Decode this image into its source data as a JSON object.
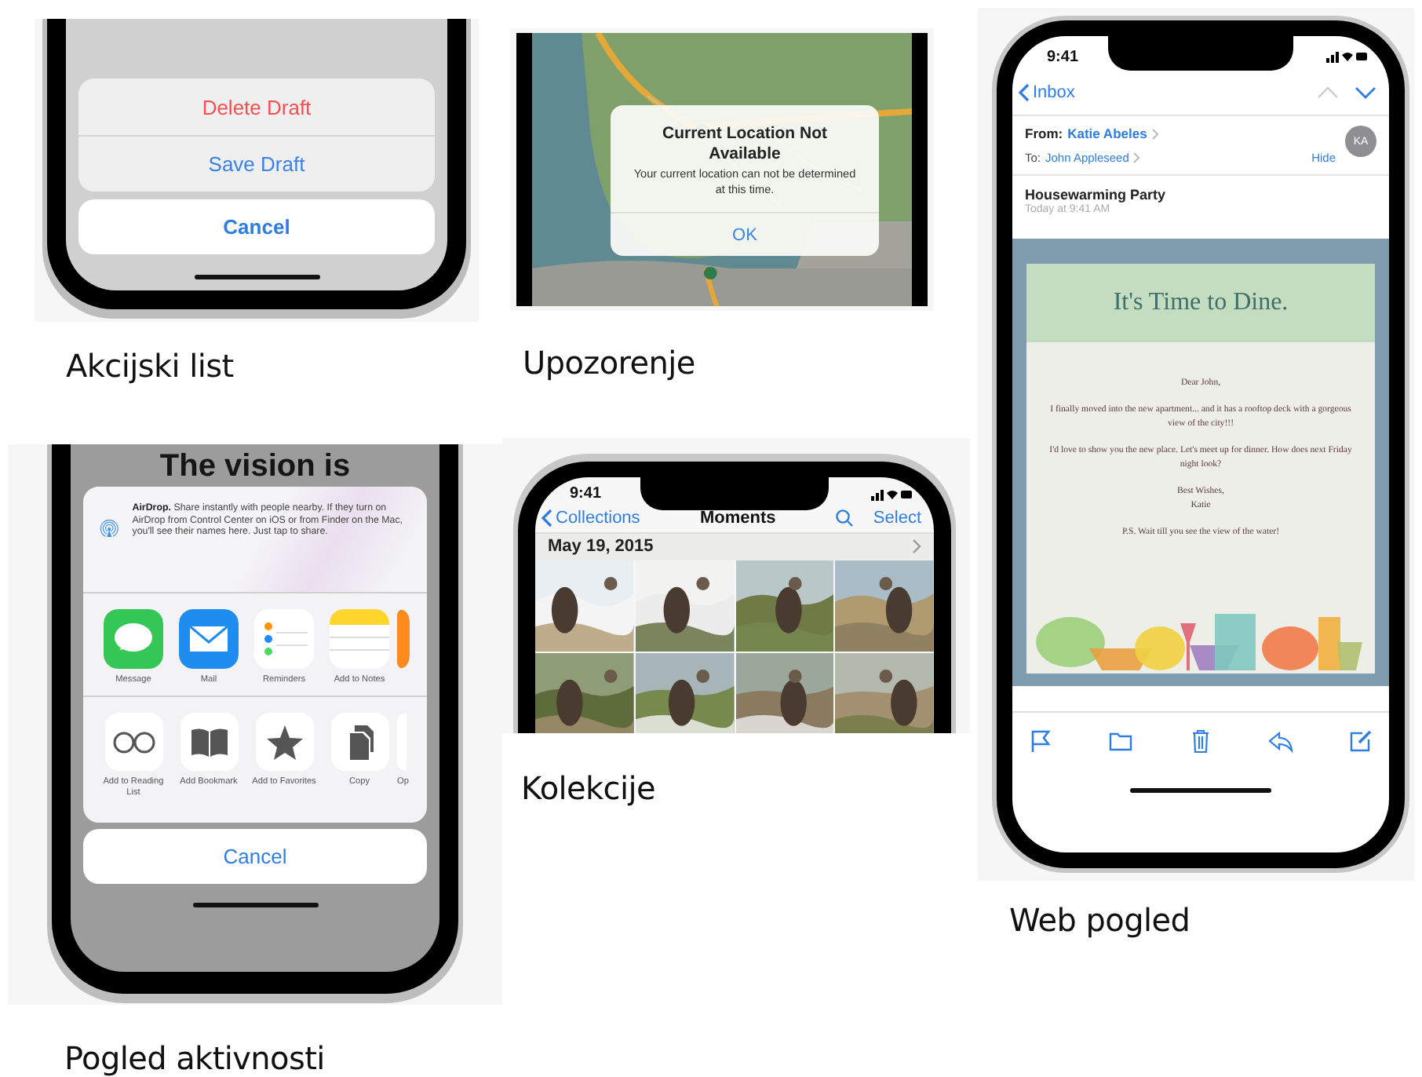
{
  "action_sheet": {
    "actions": [
      {
        "label": "Delete Draft",
        "destructive": true
      },
      {
        "label": "Save Draft",
        "destructive": false
      }
    ],
    "cancel": "Cancel",
    "caption": "Akcijski list"
  },
  "activity_view": {
    "background_text": "The vision is",
    "airdrop": {
      "title": "AirDrop.",
      "text": "Share instantly with people nearby. If they turn on AirDrop from Control Center on iOS or from Finder on the Mac, you'll see their names here. Just tap to share."
    },
    "apps": [
      {
        "kind": "message",
        "label": "Message"
      },
      {
        "kind": "mail",
        "label": "Mail"
      },
      {
        "kind": "reminders",
        "label": "Reminders"
      },
      {
        "kind": "notes",
        "label": "Add to Notes"
      },
      {
        "kind": "partial"
      }
    ],
    "actions": [
      {
        "kind": "glasses",
        "label": "Add to Reading List"
      },
      {
        "kind": "book",
        "label": "Add Bookmark"
      },
      {
        "kind": "star",
        "label": "Add to Favorites"
      },
      {
        "kind": "copy",
        "label": "Copy"
      },
      {
        "kind": "partial",
        "label": "Op"
      }
    ],
    "cancel": "Cancel",
    "caption": "Pogled aktivnosti"
  },
  "alert": {
    "title": "Current Location Not Available",
    "message": "Your current location can not be determined at this time.",
    "button": "OK",
    "caption": "Upozorenje"
  },
  "photos": {
    "time": "9:41",
    "back": "Collections",
    "title": "Moments",
    "select": "Select",
    "date": "May 19, 2015",
    "caption": "Kolekcije"
  },
  "mail": {
    "time": "9:41",
    "back": "Inbox",
    "from_label": "From:",
    "from": "Katie Abeles",
    "to_label": "To:",
    "to": "John Appleseed",
    "hide": "Hide",
    "avatar": "KA",
    "subject": "Housewarming Party",
    "date": "Today at 9:41 AM",
    "letter_title": "It's Time to Dine.",
    "letter_lines": [
      "Dear John,",
      "I finally moved into the new apartment... and it has a rooftop deck with a gorgeous view of the city!!!",
      "I'd love to show you the new place. Let's meet up for dinner. How does next Friday night look?",
      "Best Wishes,",
      "Katie",
      "P.S. Wait till you see the view of the water!"
    ],
    "caption": "Web pogled"
  }
}
